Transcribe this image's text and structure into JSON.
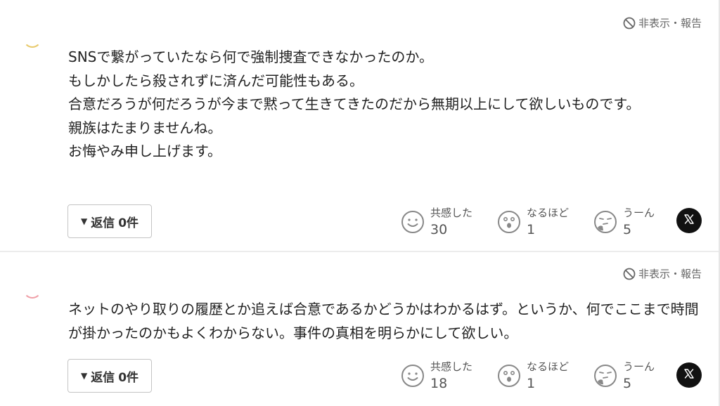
{
  "colors": {
    "text": "#222222",
    "muted": "#666666",
    "icon": "#888888",
    "x_button": "#111111",
    "avatar1_accent": "#e8c96a",
    "avatar2_accent": "#f0a0a8"
  },
  "comments": [
    {
      "report_label": "非表示・報告",
      "body": "SNSで繋がっていたなら何で強制捜査できなかったのか。\nもしかしたら殺されずに済んだ可能性もある。\n合意だろうが何だろうが今まで黙って生きてきたのだから無期以上にして欲しいものです。\n親族はたまりませんね。\nお悔やみ申し上げます。",
      "reply_label": "返信",
      "reply_count": "0件",
      "reactions": [
        {
          "label": "共感した",
          "count": "30",
          "icon": "smile-face-icon"
        },
        {
          "label": "なるほど",
          "count": "1",
          "icon": "surprised-face-icon"
        },
        {
          "label": "うーん",
          "count": "5",
          "icon": "thinking-face-icon"
        }
      ],
      "share_icon": "x-logo-icon"
    },
    {
      "report_label": "非表示・報告",
      "body": "ネットのやり取りの履歴とか追えば合意であるかどうかはわかるはず。というか、何でここまで時間が掛かったのかもよくわからない。事件の真相を明らかにして欲しい。",
      "reply_label": "返信",
      "reply_count": "0件",
      "reactions": [
        {
          "label": "共感した",
          "count": "18",
          "icon": "smile-face-icon"
        },
        {
          "label": "なるほど",
          "count": "1",
          "icon": "surprised-face-icon"
        },
        {
          "label": "うーん",
          "count": "5",
          "icon": "thinking-face-icon"
        }
      ],
      "share_icon": "x-logo-icon"
    }
  ]
}
